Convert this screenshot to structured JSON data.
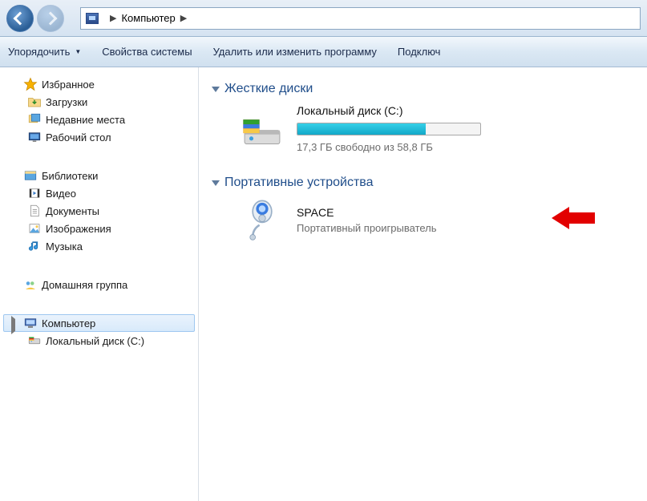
{
  "breadcrumb": {
    "root_label": "Компьютер"
  },
  "toolbar": {
    "organize": "Упорядочить",
    "sysprops": "Свойства системы",
    "uninstall": "Удалить или изменить программу",
    "connect": "Подключ"
  },
  "sidebar": {
    "favorites": {
      "label": "Избранное",
      "items": [
        {
          "label": "Загрузки"
        },
        {
          "label": "Недавние места"
        },
        {
          "label": "Рабочий стол"
        }
      ]
    },
    "libraries": {
      "label": "Библиотеки",
      "items": [
        {
          "label": "Видео"
        },
        {
          "label": "Документы"
        },
        {
          "label": "Изображения"
        },
        {
          "label": "Музыка"
        }
      ]
    },
    "homegroup": {
      "label": "Домашняя группа"
    },
    "computer": {
      "label": "Компьютер",
      "items": [
        {
          "label": "Локальный диск (C:)"
        }
      ]
    }
  },
  "main": {
    "group_drives": "Жесткие диски",
    "drive_c": {
      "title": "Локальный диск (C:)",
      "free_text": "17,3 ГБ свободно из 58,8 ГБ",
      "fill_percent": 70
    },
    "group_portable": "Портативные устройства",
    "portable_device": {
      "title": "SPACE",
      "subtitle": "Портативный проигрыватель"
    }
  }
}
